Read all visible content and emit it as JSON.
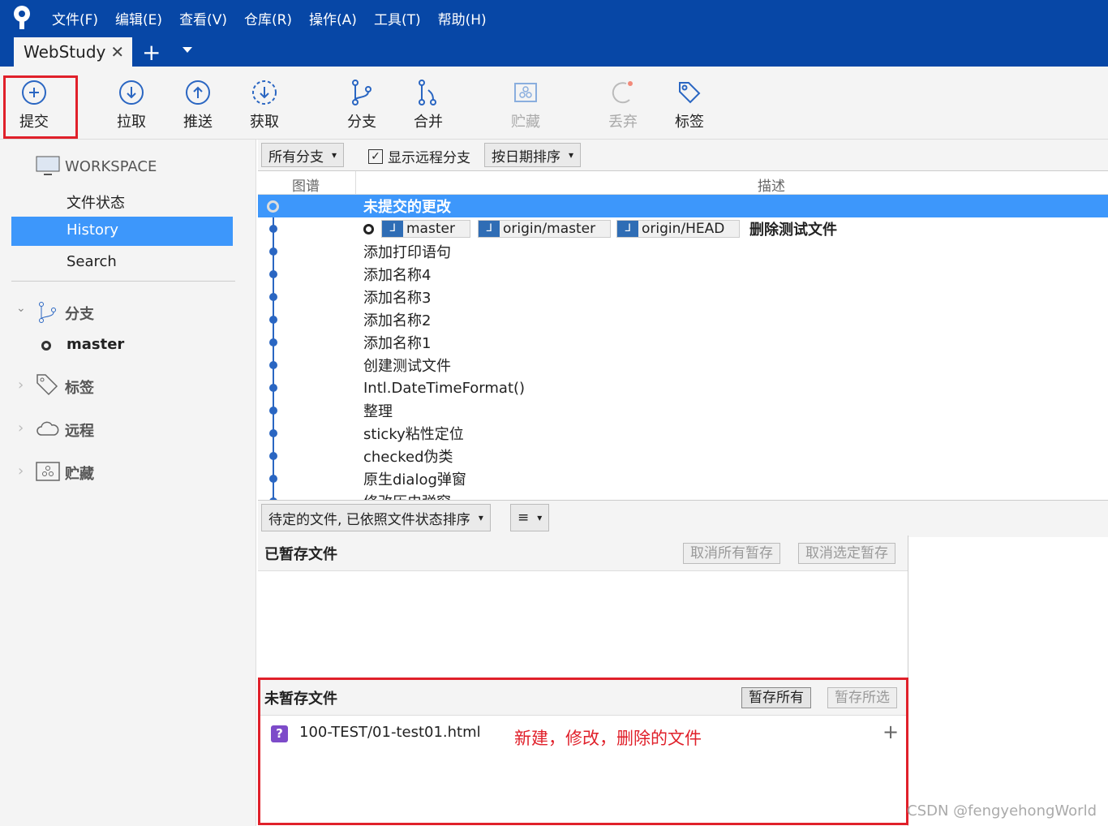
{
  "menu": [
    "文件(F)",
    "编辑(E)",
    "查看(V)",
    "仓库(R)",
    "操作(A)",
    "工具(T)",
    "帮助(H)"
  ],
  "tab": {
    "title": "WebStudy",
    "close": "✕",
    "add": "+"
  },
  "toolbar": {
    "commit": "提交",
    "pull": "拉取",
    "push": "推送",
    "fetch": "获取",
    "branch": "分支",
    "merge": "合并",
    "stash": "贮藏",
    "discard": "丢弃",
    "tag": "标签"
  },
  "sidebar": {
    "workspace": "WORKSPACE",
    "file_status": "文件状态",
    "history": "History",
    "search": "Search",
    "branches": "分支",
    "master": "master",
    "tags": "标签",
    "remotes": "远程",
    "stashes": "贮藏"
  },
  "filter": {
    "branches": "所有分支",
    "show_remote": "显示远程分支",
    "sort": "按日期排序"
  },
  "columns": {
    "graph": "图谱",
    "desc": "描述"
  },
  "commits": {
    "uncommitted": "未提交的更改",
    "head_msg": "删除测试文件",
    "refs": [
      "master",
      "origin/master",
      "origin/HEAD"
    ],
    "list": [
      "添加打印语句",
      "添加名称4",
      "添加名称3",
      "添加名称2",
      "添加名称1",
      "创建测试文件",
      "Intl.DateTimeFormat()",
      "整理",
      "sticky粘性定位",
      "checked伪类",
      "原生dialog弹窗",
      "修改历史弹窗"
    ]
  },
  "files": {
    "sort": "待定的文件, 已依照文件状态排序",
    "view": "≡"
  },
  "staged": {
    "title": "已暂存文件",
    "unstage_all": "取消所有暂存",
    "unstage_sel": "取消选定暂存"
  },
  "unstaged": {
    "title": "未暂存文件",
    "stage_all": "暂存所有",
    "stage_sel": "暂存所选",
    "file": "100-TEST/01-test01.html",
    "annotation": "新建，修改，删除的文件"
  },
  "watermark": "CSDN @fengyehongWorld",
  "colors": {
    "accent": "#0747a6",
    "selection": "#3d97fb",
    "highlight": "#e0202a"
  }
}
